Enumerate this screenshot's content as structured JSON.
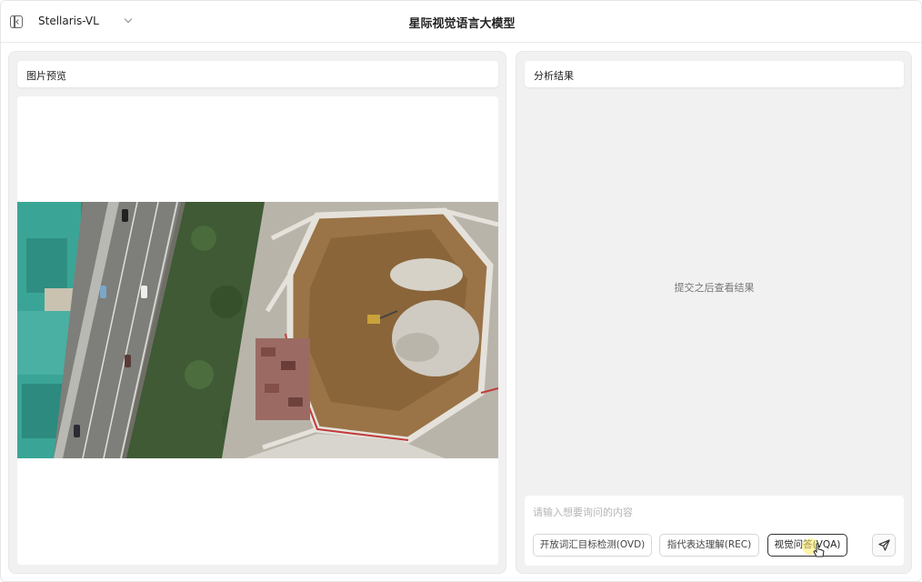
{
  "header": {
    "model_name": "Stellaris-VL",
    "title": "星际视觉语言大模型"
  },
  "left_panel": {
    "title": "图片预览"
  },
  "right_panel": {
    "title": "分析结果",
    "empty_text": "提交之后查看结果",
    "input_placeholder": "请输入想要询问的内容",
    "modes": [
      {
        "label": "开放词汇目标检测(OVD)",
        "active": false
      },
      {
        "label": "指代表达理解(REC)",
        "active": false
      },
      {
        "label": "视觉问答(VQA)",
        "active": true
      }
    ]
  },
  "icons": {
    "sidebar_toggle": "sidebar-toggle-icon",
    "dropdown": "chevron-down-icon",
    "send": "send-icon",
    "cursor": "pointer-cursor-icon"
  },
  "colors": {
    "panel_bg": "#f1f1f1",
    "active_border": "#333333"
  }
}
